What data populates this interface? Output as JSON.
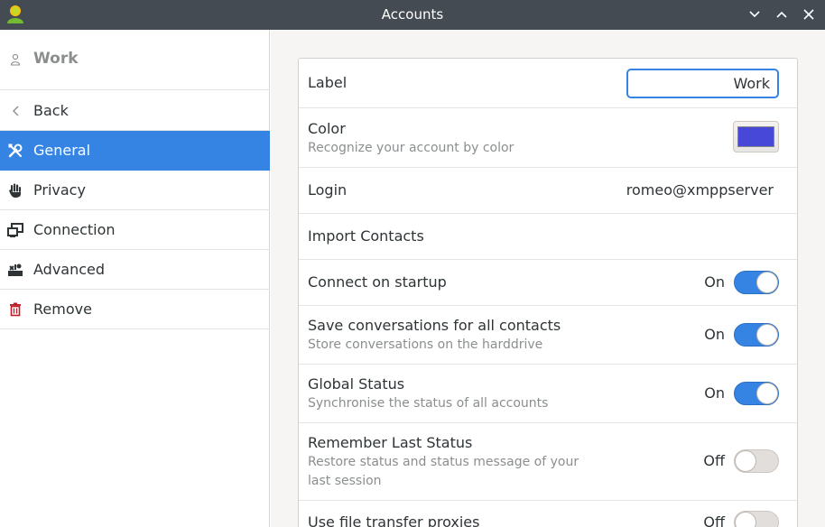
{
  "window": {
    "title": "Accounts"
  },
  "sidebar": {
    "account_name": "Work",
    "items": [
      {
        "label": "Back",
        "icon": "chevron-left-icon"
      },
      {
        "label": "General",
        "icon": "tools-icon"
      },
      {
        "label": "Privacy",
        "icon": "hand-icon"
      },
      {
        "label": "Connection",
        "icon": "network-icon"
      },
      {
        "label": "Advanced",
        "icon": "advanced-icon"
      },
      {
        "label": "Remove",
        "icon": "trash-icon"
      }
    ]
  },
  "settings": {
    "label": {
      "title": "Label",
      "value": "Work"
    },
    "color": {
      "title": "Color",
      "subtitle": "Recognize your account by color",
      "value": "#4848d8"
    },
    "login": {
      "title": "Login",
      "value": "romeo@xmppserver"
    },
    "import_contacts": {
      "title": "Import Contacts"
    },
    "connect_on_startup": {
      "title": "Connect on startup",
      "state": "On"
    },
    "save_conversations": {
      "title": "Save conversations for all contacts",
      "subtitle": "Store conversations on the harddrive",
      "state": "On"
    },
    "global_status": {
      "title": "Global Status",
      "subtitle": "Synchronise the status of all accounts",
      "state": "On"
    },
    "remember_last_status": {
      "title": "Remember Last Status",
      "subtitle": "Restore status and status message of your last session",
      "state": "Off"
    },
    "file_transfer_proxies": {
      "title": "Use file transfer proxies",
      "state": "Off"
    }
  },
  "colors": {
    "accent": "#3584e4",
    "titlebar": "#444b52",
    "remove_icon": "#c01c28"
  }
}
